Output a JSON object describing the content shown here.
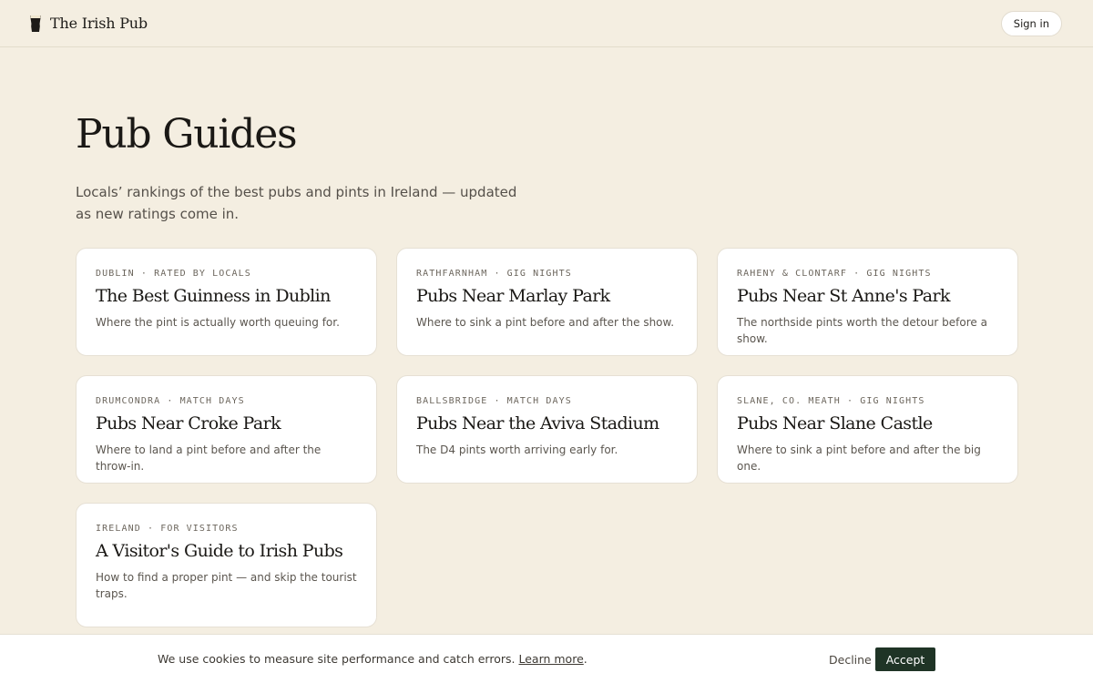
{
  "header": {
    "logo_icon": "pint-glass-icon",
    "brand_name": "The Irish Pub",
    "signin_label": "Sign in"
  },
  "hero": {
    "title": "Pub Guides",
    "subtitle": "Locals’ rankings of the best pubs and pints in Ireland — updated as new ratings come in."
  },
  "guides": [
    {
      "meta": "Dublin · Rated by locals",
      "title": "The Best Guinness in Dublin",
      "description": "Where the pint is actually worth queuing for."
    },
    {
      "meta": "Rathfarnham · Gig nights",
      "title": "Pubs Near Marlay Park",
      "description": "Where to sink a pint before and after the show."
    },
    {
      "meta": "Raheny & Clontarf · Gig nights",
      "title": "Pubs Near St Anne's Park",
      "description": "The northside pints worth the detour before a show."
    },
    {
      "meta": "Drumcondra · Match days",
      "title": "Pubs Near Croke Park",
      "description": "Where to land a pint before and after the throw-in."
    },
    {
      "meta": "Ballsbridge · Match days",
      "title": "Pubs Near the Aviva Stadium",
      "description": "The D4 pints worth arriving early for."
    },
    {
      "meta": "Slane, Co. Meath · Gig nights",
      "title": "Pubs Near Slane Castle",
      "description": "Where to sink a pint before and after the big one."
    },
    {
      "meta": "Ireland · For visitors",
      "title": "A Visitor's Guide to Irish Pubs",
      "description": "How to find a proper pint — and skip the tourist traps."
    }
  ],
  "cookie_banner": {
    "message": "We use cookies to measure site performance and catch errors.",
    "link_label": "Learn more",
    "link_suffix": ".",
    "decline_label": "Decline",
    "accept_label": "Accept"
  },
  "colors": {
    "background": "#f4eee1",
    "card": "#ffffff",
    "accent_button": "#1f3426"
  }
}
